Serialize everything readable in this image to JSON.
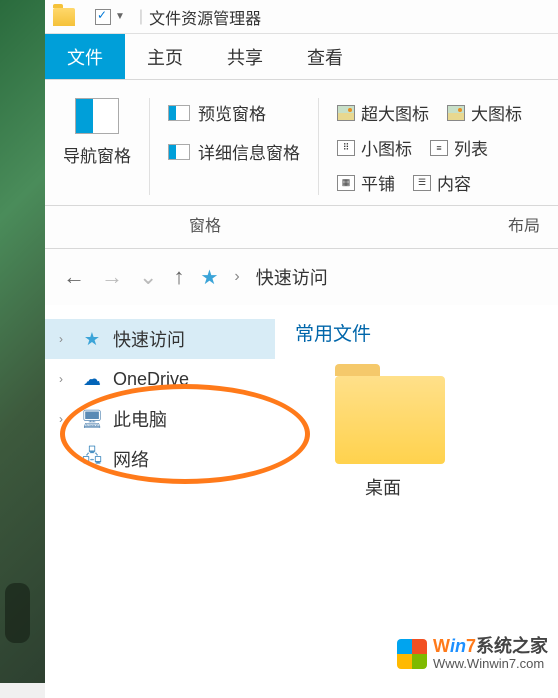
{
  "titlebar": {
    "app_title": "文件资源管理器"
  },
  "tabs": {
    "file": "文件",
    "home": "主页",
    "share": "共享",
    "view": "查看"
  },
  "ribbon": {
    "nav_pane": "导航窗格",
    "preview_pane": "预览窗格",
    "details_pane": "详细信息窗格",
    "extra_large": "超大图标",
    "large": "大图标",
    "small": "小图标",
    "list": "列表",
    "tiles": "平铺",
    "content": "内容",
    "group_panes": "窗格",
    "group_layout": "布局"
  },
  "navbar": {
    "location": "快速访问"
  },
  "tree": {
    "quick_access": "快速访问",
    "onedrive": "OneDrive",
    "this_pc": "此电脑",
    "network": "网络"
  },
  "content": {
    "heading": "常用文件",
    "folder1": "桌面"
  },
  "watermark": {
    "brand_w": "W",
    "brand_in": "in",
    "brand_n": "7",
    "brand_rest": "系统之家",
    "url": "Www.Winwin7.com"
  }
}
